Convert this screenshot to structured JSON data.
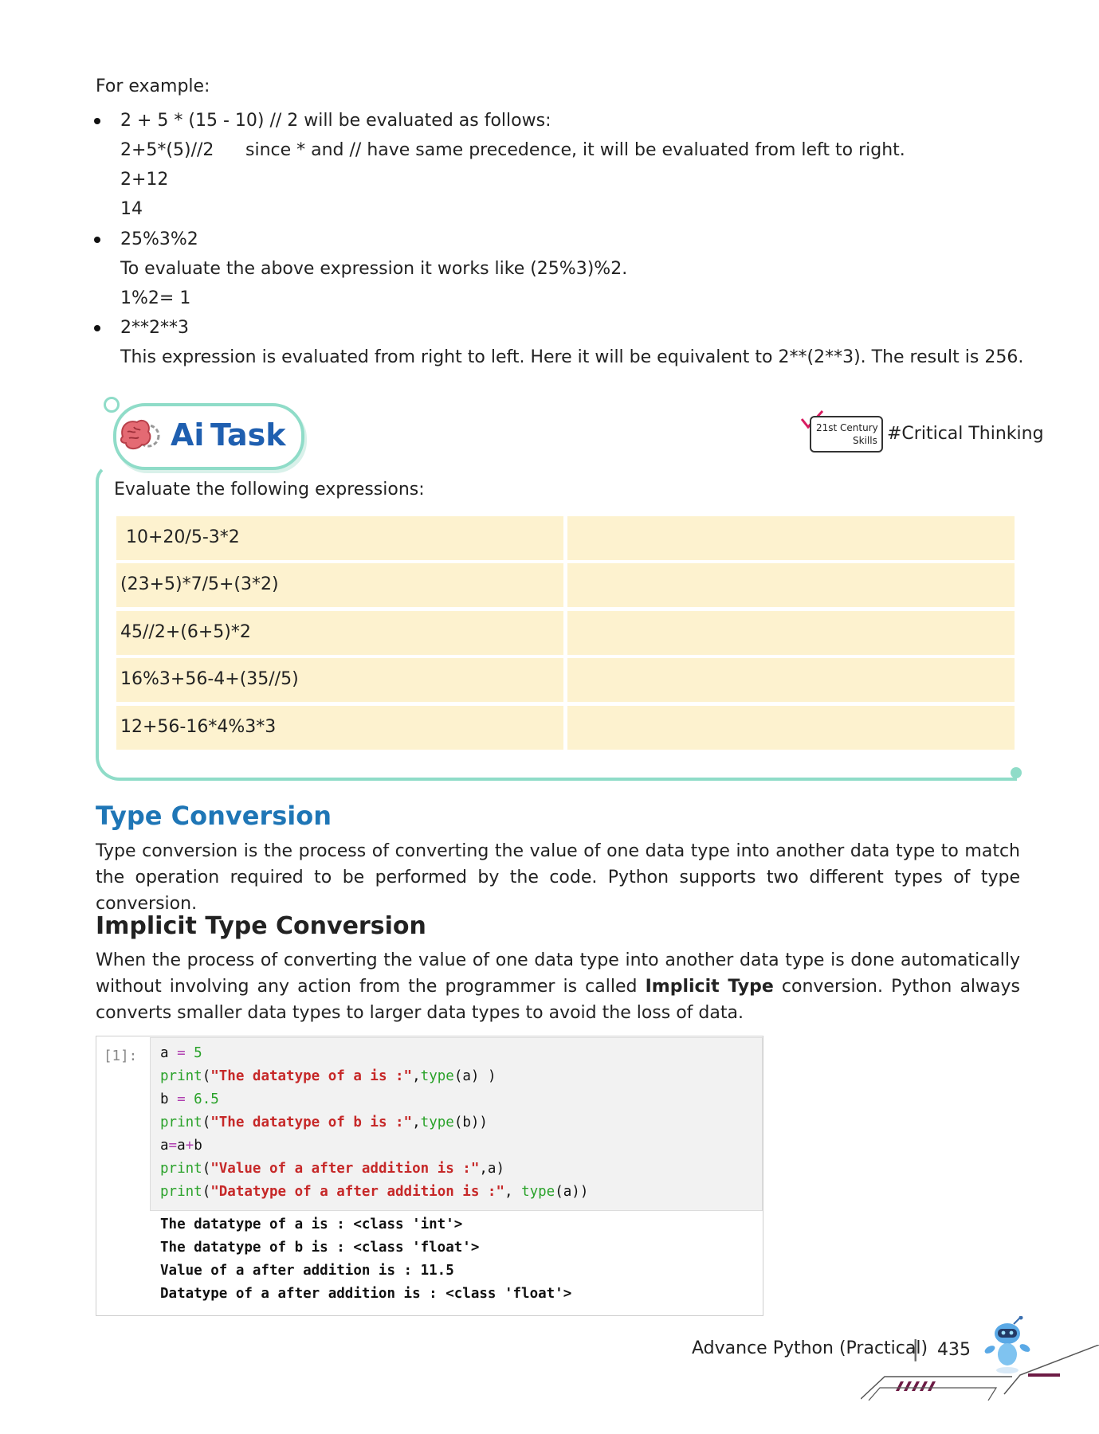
{
  "intro": "For example:",
  "examples": [
    {
      "expression": "2 + 5 * (15 - 10) // 2 will be evaluated as follows:",
      "steps": [
        "2+5*(5)//2",
        "2+12",
        "14"
      ],
      "note": "since * and // have same precedence, it will be evaluated from left to right."
    },
    {
      "expression": "25%3%2",
      "steps": [
        "To evaluate the above expression it works like (25%3)%2.",
        "1%2= 1"
      ]
    },
    {
      "expression": "2**2**3",
      "steps": [
        "This expression is evaluated from right to left. Here it will be equivalent to 2**(2**3). The result is 256."
      ]
    }
  ],
  "task": {
    "label_ai": "Ai",
    "label_task": "Task",
    "skills_line1": "21st Century",
    "skills_line2": "Skills",
    "hashtag": "#Critical Thinking",
    "instruction": "Evaluate the following expressions:",
    "rows": [
      {
        "expr": "10+20/5-3*2",
        "answer": ""
      },
      {
        "expr": "(23+5)*7/5+(3*2)",
        "answer": ""
      },
      {
        "expr": "45//2+(6+5)*2",
        "answer": ""
      },
      {
        "expr": "16%3+56-4+(35//5)",
        "answer": ""
      },
      {
        "expr": "12+56-16*4%3*3",
        "answer": ""
      }
    ]
  },
  "type_conversion": {
    "heading": "Type Conversion",
    "body": "Type conversion is the process of converting the value of one data type into another data type to match the operation required to be performed by the code. Python supports two different types of type conversion."
  },
  "implicit": {
    "heading": "Implicit Type Conversion",
    "body_before": "When the process of converting the value of one data type into another data type is done automatically without involving any action from the programmer is called ",
    "body_bold": "Implicit Type",
    "body_after": " conversion. Python always converts smaller data types to larger data types to avoid the loss of data."
  },
  "notebook": {
    "prompt": "[1]:",
    "code": {
      "l1_var": "a",
      "l1_eq": " = ",
      "l1_val": "5",
      "l2_fn": "print",
      "l2_p": "(",
      "l2_str": "\"The datatype of a is :\"",
      "l2_comma": ",",
      "l2_fn2": "type",
      "l2_rest": "(a) )",
      "l3_var": "b",
      "l3_eq": " = ",
      "l3_val": "6.5",
      "l4_fn": "print",
      "l4_p": "(",
      "l4_str": "\"The datatype of b is :\"",
      "l4_comma": ",",
      "l4_fn2": "type",
      "l4_rest": "(b))",
      "l5_a": "a",
      "l5_eq": "=",
      "l5_a2": "a",
      "l5_plus": "+",
      "l5_b": "b",
      "l6_fn": "print",
      "l6_p": "(",
      "l6_str": "\"Value of a after addition is :\"",
      "l6_rest": ",a)",
      "l7_fn": "print",
      "l7_p": "(",
      "l7_str": "\"Datatype of a after addition is :\"",
      "l7_comma": ", ",
      "l7_fn2": "type",
      "l7_rest": "(a))"
    },
    "output": [
      "The datatype of a is : <class 'int'>",
      "The datatype of b is : <class 'float'>",
      "Value of a after addition is : 11.5",
      "Datatype of a after addition is : <class 'float'>"
    ]
  },
  "footer": {
    "book": "Advance Python (Practical)",
    "separator": "|",
    "page": "435"
  },
  "colors": {
    "heading_blue": "#1f76b6",
    "task_mint": "#8fdcc8",
    "cell_yellow": "#fdf2cf",
    "code_green": "#2aa22a",
    "code_red": "#c62828",
    "footer_maroon": "#6d1b45"
  }
}
